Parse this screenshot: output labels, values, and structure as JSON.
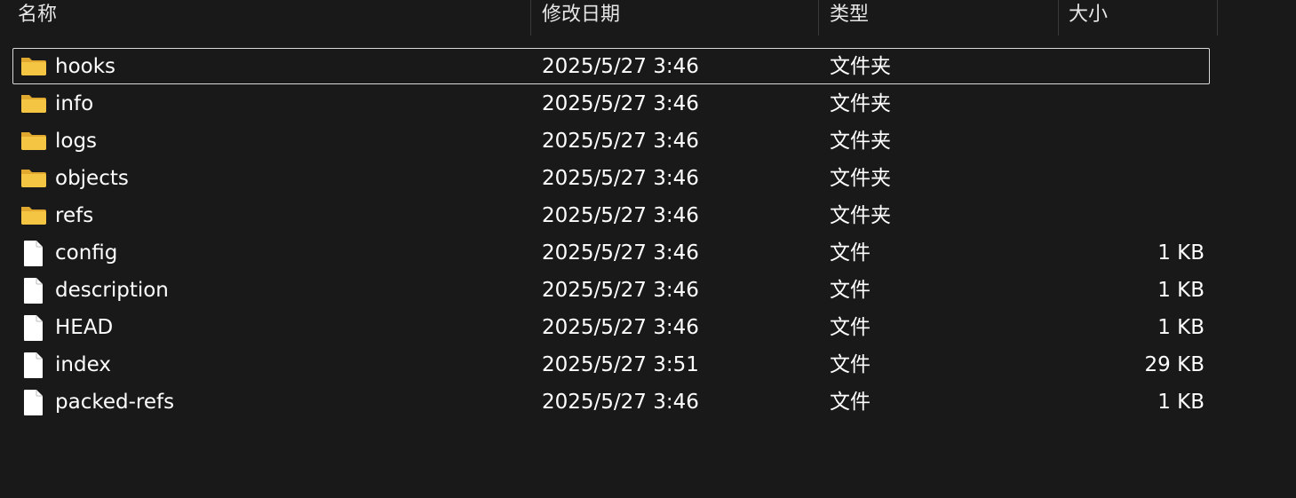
{
  "columns": {
    "name": "名称",
    "date": "修改日期",
    "type": "类型",
    "size": "大小"
  },
  "files": [
    {
      "name": "hooks",
      "date": "2025/5/27 3:46",
      "type": "文件夹",
      "size": "",
      "icon": "folder-icon",
      "selected": true
    },
    {
      "name": "info",
      "date": "2025/5/27 3:46",
      "type": "文件夹",
      "size": "",
      "icon": "folder-icon"
    },
    {
      "name": "logs",
      "date": "2025/5/27 3:46",
      "type": "文件夹",
      "size": "",
      "icon": "folder-icon"
    },
    {
      "name": "objects",
      "date": "2025/5/27 3:46",
      "type": "文件夹",
      "size": "",
      "icon": "folder-icon"
    },
    {
      "name": "refs",
      "date": "2025/5/27 3:46",
      "type": "文件夹",
      "size": "",
      "icon": "folder-icon"
    },
    {
      "name": "config",
      "date": "2025/5/27 3:46",
      "type": "文件",
      "size": "1 KB",
      "icon": "file-icon"
    },
    {
      "name": "description",
      "date": "2025/5/27 3:46",
      "type": "文件",
      "size": "1 KB",
      "icon": "file-icon"
    },
    {
      "name": "HEAD",
      "date": "2025/5/27 3:46",
      "type": "文件",
      "size": "1 KB",
      "icon": "file-icon"
    },
    {
      "name": "index",
      "date": "2025/5/27 3:51",
      "type": "文件",
      "size": "29 KB",
      "icon": "file-icon"
    },
    {
      "name": "packed-refs",
      "date": "2025/5/27 3:46",
      "type": "文件",
      "size": "1 KB",
      "icon": "file-icon"
    }
  ],
  "colors": {
    "background": "#191919",
    "folder": "#f4c542",
    "folder_dark": "#e0a82e",
    "file": "#ffffff"
  }
}
